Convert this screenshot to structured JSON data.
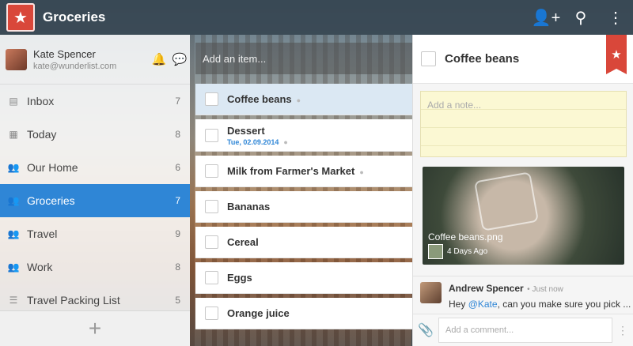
{
  "app": {
    "title": "Groceries",
    "logo_icon": "star-icon"
  },
  "topbar": {
    "icons": [
      "add-person-icon",
      "search-icon",
      "more-vertical-icon"
    ]
  },
  "user": {
    "name": "Kate Spencer",
    "email": "kate@wunderlist.com"
  },
  "sidebar": {
    "items": [
      {
        "label": "Inbox",
        "count": "7",
        "icon": "inbox-icon"
      },
      {
        "label": "Today",
        "count": "8",
        "icon": "calendar-icon"
      },
      {
        "label": "Our Home",
        "count": "6",
        "icon": "shared-list-icon"
      },
      {
        "label": "Groceries",
        "count": "7",
        "icon": "shared-list-icon",
        "active": true
      },
      {
        "label": "Travel",
        "count": "9",
        "icon": "shared-list-icon"
      },
      {
        "label": "Work",
        "count": "8",
        "icon": "shared-list-icon"
      },
      {
        "label": "Travel Packing List",
        "count": "5",
        "icon": "list-icon"
      }
    ],
    "add_label": "+"
  },
  "tasks": {
    "placeholder": "Add an item...",
    "items": [
      {
        "title": "Coffee beans",
        "date": "",
        "selected": true
      },
      {
        "title": "Dessert",
        "date": "Tue, 02.09.2014"
      },
      {
        "title": "Milk from Farmer's Market",
        "date": ""
      },
      {
        "title": "Bananas",
        "date": ""
      },
      {
        "title": "Cereal",
        "date": ""
      },
      {
        "title": "Eggs",
        "date": ""
      },
      {
        "title": "Orange juice",
        "date": ""
      }
    ]
  },
  "detail": {
    "title": "Coffee beans",
    "note_placeholder": "Add a note...",
    "file": {
      "name": "Coffee beans.png",
      "time": "4 Days Ago"
    },
    "comment": {
      "author": "Andrew Spencer",
      "time": "Just now",
      "prefix": "Hey ",
      "mention": "@Kate",
      "rest": ", can you make sure you pick ..."
    },
    "comment_placeholder": "Add a comment..."
  },
  "colors": {
    "accent": "#2f86d6",
    "brand": "#d9473a"
  }
}
